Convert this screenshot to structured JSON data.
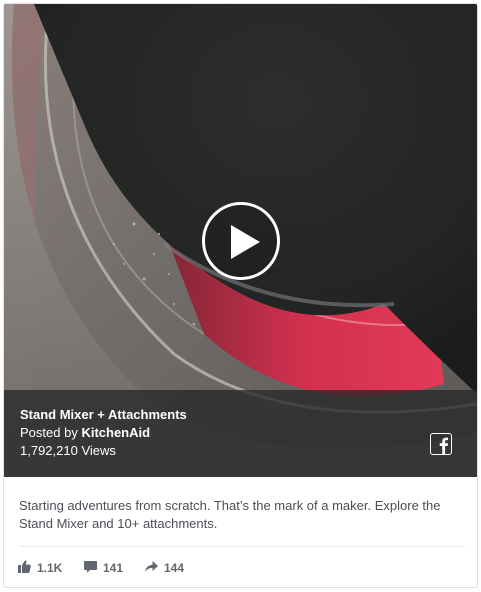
{
  "video": {
    "title": "Stand Mixer + Attachments",
    "posted_prefix": "Posted by ",
    "author": "KitchenAid",
    "views": "1,792,210 Views",
    "play_icon": "play-icon",
    "brand_icon": "facebook-f-logo-icon"
  },
  "post": {
    "description": "Starting adventures from scratch. That’s the mark of a maker. Explore the Stand Mixer and 10+ attachments."
  },
  "stats": {
    "likes": "1.1K",
    "comments": "141",
    "shares": "144",
    "icons": [
      "thumbs-up-icon",
      "comment-icon",
      "share-arrow-icon"
    ]
  },
  "colors": {
    "overlay": "#282828",
    "text_secondary": "#4b4f56",
    "stat_text": "#606770",
    "border": "#dddfe2"
  }
}
